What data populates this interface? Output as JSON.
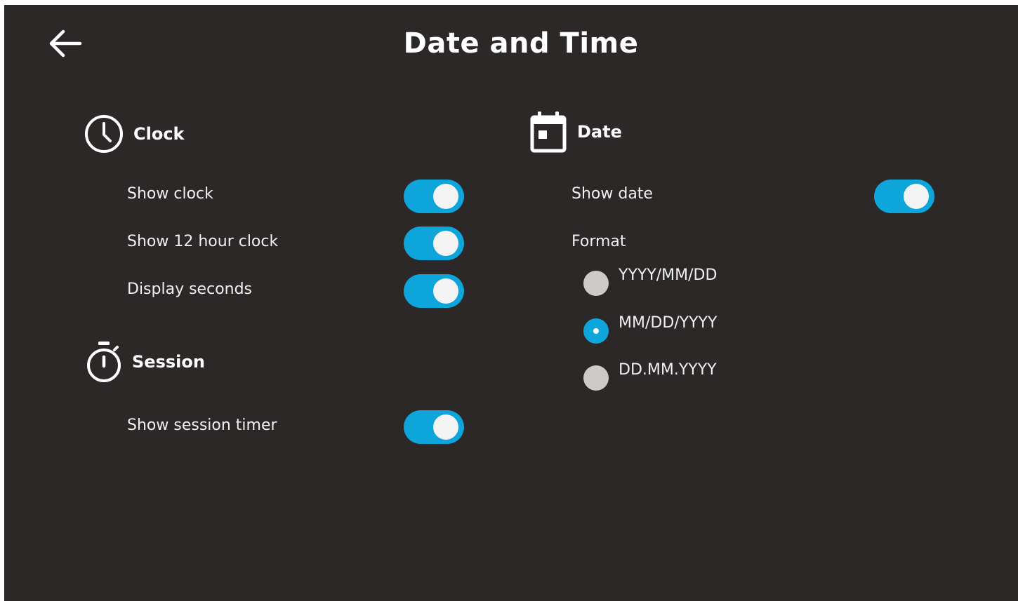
{
  "header": {
    "title": "Date and Time",
    "back_icon": "arrow-left-icon"
  },
  "clock": {
    "title": "Clock",
    "icon": "clock-icon",
    "settings": [
      {
        "label": "Show clock",
        "enabled": true
      },
      {
        "label": "Show 12 hour clock",
        "enabled": true
      },
      {
        "label": "Display seconds",
        "enabled": true
      }
    ]
  },
  "session": {
    "title": "Session",
    "icon": "stopwatch-icon",
    "settings": [
      {
        "label": "Show session timer",
        "enabled": true
      }
    ]
  },
  "date": {
    "title": "Date",
    "icon": "calendar-icon",
    "show_date": {
      "label": "Show date",
      "enabled": true
    },
    "format_label": "Format",
    "formats": [
      {
        "label": "YYYY/MM/DD",
        "selected": false
      },
      {
        "label": "MM/DD/YYYY",
        "selected": true
      },
      {
        "label": "DD.MM.YYYY",
        "selected": false
      }
    ]
  },
  "colors": {
    "background": "#2b2827",
    "accent": "#0ea5db",
    "radio_unselected": "#cdcac8",
    "text": "#f0f0f0"
  }
}
